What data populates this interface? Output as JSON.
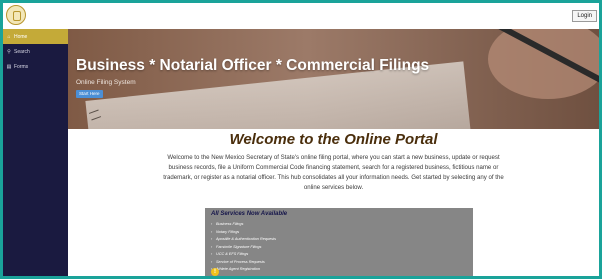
{
  "topbar": {
    "login_label": "Login"
  },
  "sidebar": {
    "items": [
      {
        "label": "Home",
        "icon": "home-icon",
        "glyph": "⌂"
      },
      {
        "label": "Search",
        "icon": "search-icon",
        "glyph": "⚲"
      },
      {
        "label": "Forms",
        "icon": "document-icon",
        "glyph": "▤"
      }
    ]
  },
  "hero": {
    "title": "Business * Notarial Officer * Commercial Filings",
    "subtitle": "Online Filing System",
    "start_label": "Start Here"
  },
  "main": {
    "welcome_title": "Welcome to the Online Portal",
    "intro_text": "Welcome to the New Mexico Secretary of State's online filing portal, where you can start a new business, update or request business records, file a Uniform Commercial Code financing statement, search for a registered business, fictitious name or trademark, or register as a notarial officer. This hub consolidates all your information needs. Get started by selecting any of the online services below."
  },
  "services": {
    "title": "All Services Now Available",
    "items": [
      "Business Filings",
      "Notary Filings",
      "Apostille & Authentication Requests",
      "Facsimile Signature Filings",
      "UCC & EFS Filings",
      "Service of Process Requests",
      "Athlete Agent Registration"
    ]
  },
  "colors": {
    "outer_frame": "#1aa39a",
    "sidebar_bg": "#1a1a40",
    "sidebar_active": "#c4aa38",
    "welcome_text": "#4a2e0c",
    "services_bg": "#868686",
    "start_button": "#4b8fd6"
  }
}
